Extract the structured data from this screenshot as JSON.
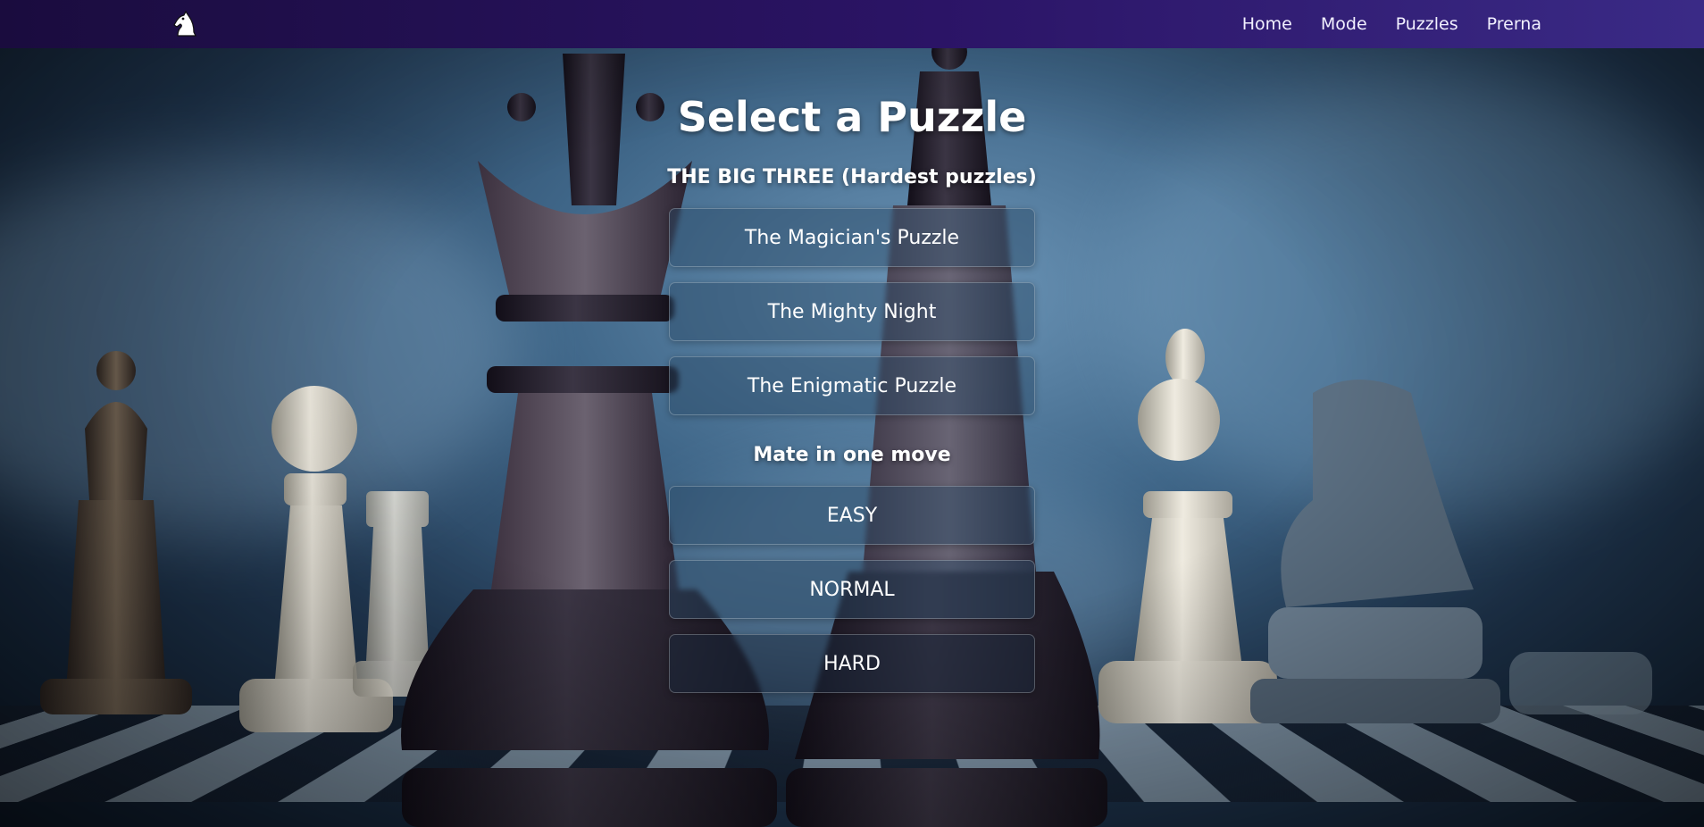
{
  "nav": {
    "logo_icon": "chess-knight-icon",
    "links": [
      "Home",
      "Mode",
      "Puzzles",
      "Prerna"
    ]
  },
  "main": {
    "title": "Select a Puzzle",
    "big_three": {
      "heading": "THE BIG THREE (Hardest puzzles)",
      "puzzles": [
        "The Magician's Puzzle",
        "The Mighty Night",
        "The Enigmatic Puzzle"
      ]
    },
    "mate_in_one": {
      "heading": "Mate in one move",
      "levels": [
        "EASY",
        "NORMAL",
        "HARD"
      ]
    }
  },
  "colors": {
    "navbar_start": "#1a0c3e",
    "navbar_end": "#3a2a86",
    "button_bg": "#2a4664",
    "text": "#ffffff"
  }
}
